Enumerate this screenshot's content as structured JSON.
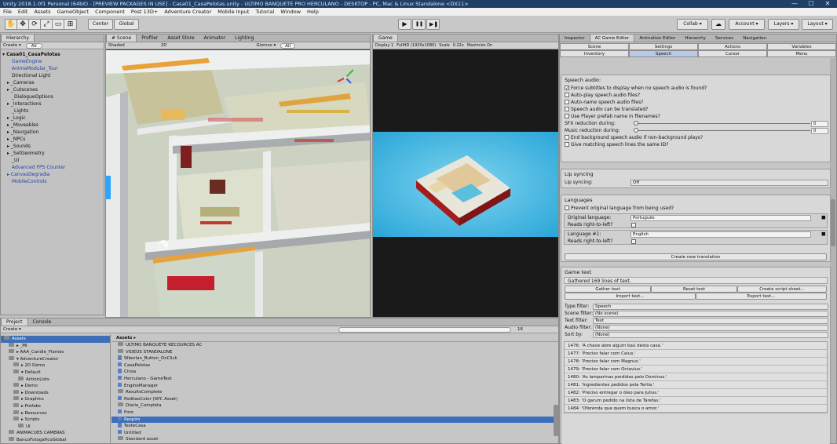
{
  "window": {
    "title": "Unity 2018.1.0f1 Personal (64bit) - [PREVIEW PACKAGES IN USE] - Casa01_CasaPelotas.unity - ULTIMO BANQUETE PRO HERCULANO - DESKTOP - PC, Mac & Linux Standalone <DX11>",
    "controls": [
      "—",
      "☐",
      "✕"
    ]
  },
  "menu": [
    "File",
    "Edit",
    "Assets",
    "GameObject",
    "Component",
    "Post 13D+",
    "Adventure Creator",
    "Mobile Input",
    "Tutorial",
    "Window",
    "Help"
  ],
  "toolbar": {
    "tools": [
      "✋",
      "✥",
      "⟳",
      "⤢",
      "▭",
      "⊞"
    ],
    "pivot": "Center",
    "space": "Global",
    "play": [
      "▶",
      "❚❚",
      "▶❚"
    ],
    "collab": "Collab ▾",
    "cloud": "☁",
    "account": "Account ▾",
    "layers": "Layers ▾",
    "layout": "Layout ▾"
  },
  "hierarchy": {
    "tab": "Hierarchy",
    "create": "Create ▾",
    "search": "All",
    "root": "Casa01_CasaPelotas",
    "items": [
      {
        "label": "GameEngine",
        "style": "blue",
        "indent": 2
      },
      {
        "label": "AnimaModular_Tour",
        "style": "blue",
        "indent": 2
      },
      {
        "label": "Directional Light",
        "style": "",
        "indent": 2
      },
      {
        "label": "▸ _Cameras",
        "style": "",
        "indent": 1
      },
      {
        "label": "▸ _Cutscenes",
        "style": "",
        "indent": 1
      },
      {
        "label": "_DialogueOptions",
        "style": "",
        "indent": 2
      },
      {
        "label": "▸ _Interactions",
        "style": "",
        "indent": 1
      },
      {
        "label": "_Lights",
        "style": "",
        "indent": 2
      },
      {
        "label": "▸ _Logic",
        "style": "",
        "indent": 1
      },
      {
        "label": "▸ _Moveables",
        "style": "",
        "indent": 1
      },
      {
        "label": "▸ _Navigation",
        "style": "",
        "indent": 1
      },
      {
        "label": "▸ _NPCs",
        "style": "",
        "indent": 1
      },
      {
        "label": "▸ _Sounds",
        "style": "",
        "indent": 1
      },
      {
        "label": "▸ _SetGeometry",
        "style": "",
        "indent": 1
      },
      {
        "label": "_UI",
        "style": "",
        "indent": 2
      },
      {
        "label": "Advanced FPS Counter",
        "style": "blue",
        "indent": 2
      },
      {
        "label": "▸ CanvasDegradia",
        "style": "blue",
        "indent": 1
      },
      {
        "label": "MobileControls",
        "style": "blue",
        "indent": 2
      }
    ]
  },
  "scene": {
    "tabs": [
      "# Scene",
      "Profiler",
      "Asset Store",
      "Animator",
      "Lighting"
    ],
    "shading": "Shaded",
    "mode": "2D",
    "gizmos": "Gizmos ▾",
    "search": "All"
  },
  "game": {
    "tab": "Game",
    "display": "Display 1",
    "resolution": "FullHD (1920x1080)",
    "scale": "Scale",
    "scale_value": "0.22x",
    "maximize": "Maximize On"
  },
  "inspector": {
    "tabs": [
      "Inspector",
      "AC Game Editor",
      "Animation Editor",
      "Hierarchy",
      "Services",
      "Navigation"
    ],
    "nav_row1": [
      "Scene",
      "Settings",
      "Actions",
      "Variables"
    ],
    "nav_row2": [
      "Inventory",
      "Speech",
      "Cursor",
      "Menu"
    ],
    "speech_audio": {
      "title": "Speech audio:",
      "options": [
        {
          "label": "Force subtitles to display when no speech audio is found?",
          "checked": true
        },
        {
          "label": "Auto-play speech audio files?",
          "checked": false
        },
        {
          "label": "Auto-name speech audio files?",
          "checked": false
        },
        {
          "label": "Speech audio can be translated?",
          "checked": false
        },
        {
          "label": "Use Player prefab name in filenames?",
          "checked": false
        }
      ],
      "sfx_label": "SFX reduction during:",
      "sfx_value": "0",
      "music_label": "Music reduction during:",
      "music_value": "0",
      "tail_options": [
        {
          "label": "End background speech audio if non-background plays?",
          "checked": false
        },
        {
          "label": "Give matching speech lines the same ID?",
          "checked": false
        }
      ]
    },
    "lip_sync": {
      "title": "Lip syncing",
      "label": "Lip syncing:",
      "value": "Off"
    },
    "languages": {
      "title": "Languages",
      "prevent": "Prevent original language from being used?",
      "original_label": "Original language:",
      "original_value": "Português",
      "rtl1": "Reads right-to-left?",
      "lang1_label": "Language #1:",
      "lang1_value": "English",
      "rtl2": "Reads right-to-left?",
      "create_button": "Create new translation"
    },
    "game_text": {
      "title": "Game text",
      "gathered": "Gathered 169 lines of text.",
      "buttons": [
        "Gather text",
        "Reset text",
        "Create script sheet..."
      ],
      "buttons2": [
        "Import text...",
        "Export text..."
      ],
      "filters": [
        {
          "label": "Type filter:",
          "value": "Speech"
        },
        {
          "label": "Scene filter:",
          "value": "(No scene)"
        },
        {
          "label": "Text filter:",
          "value": "Text"
        },
        {
          "label": "Audio filter:",
          "value": "(None)"
        },
        {
          "label": "Sort by:",
          "value": "(None)"
        }
      ],
      "lines": [
        "1476: 'A chave abre algum baú desta casa.'",
        "1477: 'Preciso falar com Caius.'",
        "1478: 'Preciso falar com Magnus.'",
        "1479: 'Preciso falar com Octavius.'",
        "1480: 'As lamparinas perdidas pelo Dominus.'",
        "1481: 'Ingredientes pedidos pela Tertia.'",
        "1482: 'Preciso entregar o óleo para Julius.'",
        "1483: 'O garum pedido na lista de Tarefas.'",
        "1484: 'Oferenda que quem busca o amor.'"
      ]
    }
  },
  "project": {
    "tabs": [
      "Project",
      "Console"
    ],
    "create": "Create ▾",
    "count": "16",
    "tree": [
      {
        "label": "Assets",
        "sel": true,
        "indent": 0
      },
      {
        "label": "▸ _MI",
        "indent": 1
      },
      {
        "label": "▸ AAA_Candle_Flames",
        "indent": 1
      },
      {
        "label": "▾ AdventureCreator",
        "indent": 1
      },
      {
        "label": "▸ 2D Demo",
        "indent": 2
      },
      {
        "label": "▾ Default",
        "indent": 2
      },
      {
        "label": "ActionLists",
        "indent": 3
      },
      {
        "label": "▸ Demo",
        "indent": 2
      },
      {
        "label": "▸ Downloads",
        "indent": 2
      },
      {
        "label": "▸ Graphics",
        "indent": 2
      },
      {
        "label": "▸ Prefabs",
        "indent": 2
      },
      {
        "label": "▸ Resources",
        "indent": 2
      },
      {
        "label": "▸ Scripts",
        "indent": 2
      },
      {
        "label": "UI",
        "indent": 3
      },
      {
        "label": "ANIMACOES CAMERAS",
        "indent": 1
      },
      {
        "label": "BancoFotogaficoGlobal",
        "indent": 1
      }
    ],
    "path": "Assets ▸",
    "assets": [
      {
        "label": "ULTIMO BANQUETE RECOURCES AC",
        "type": "folder"
      },
      {
        "label": "VIDEOS STANDALONE",
        "type": "folder"
      },
      {
        "label": "Wborlan_Button_OnClick",
        "type": "file"
      },
      {
        "label": "CasaPelotas",
        "type": "file"
      },
      {
        "label": "Cinsa",
        "type": "file"
      },
      {
        "label": "Herculano - GameText",
        "type": "file"
      },
      {
        "label": "EngineManager",
        "type": "file"
      },
      {
        "label": "ResultsComplete",
        "type": "folder"
      },
      {
        "label": "PeditaoColor (SPC Asset)",
        "type": "file"
      },
      {
        "label": "Diaria_Completa",
        "type": "folder"
      },
      {
        "label": "Foto",
        "type": "file"
      },
      {
        "label": "Respiro",
        "type": "file",
        "sel": true
      },
      {
        "label": "TesteCasa",
        "type": "file"
      },
      {
        "label": "Untitled",
        "type": "file"
      },
      {
        "label": "Standard asset",
        "type": "folder"
      }
    ]
  }
}
